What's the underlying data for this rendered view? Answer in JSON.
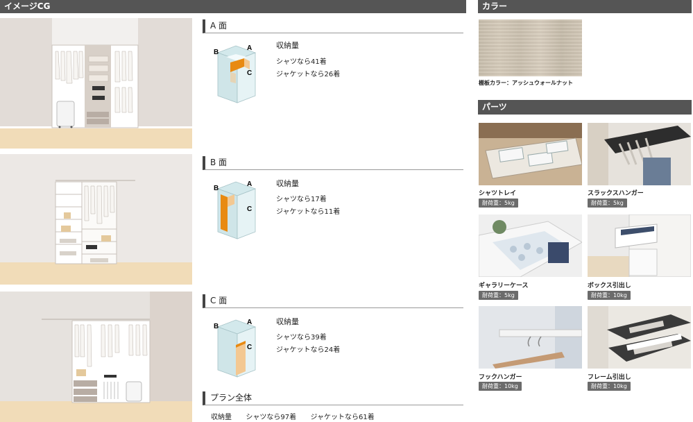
{
  "headers": {
    "image_cg": "イメージCG",
    "color": "カラー",
    "parts": "パーツ"
  },
  "sections": [
    {
      "title": "A 面",
      "capacity_label": "収納量",
      "shirts": "シャツなら41着",
      "jackets": "ジャケットなら26着"
    },
    {
      "title": "B 面",
      "capacity_label": "収納量",
      "shirts": "シャツなら17着",
      "jackets": "ジャケットなら11着"
    },
    {
      "title": "C 面",
      "capacity_label": "収納量",
      "shirts": "シャツなら39着",
      "jackets": "ジャケットなら24着"
    }
  ],
  "iso_labels": {
    "a": "A",
    "b": "B",
    "c": "C"
  },
  "plan": {
    "title": "プラン全体",
    "capacity_label": "収納量",
    "shirts": "シャツなら97着",
    "jackets": "ジャケットなら61着"
  },
  "color": {
    "caption": "棚板カラー：アッシュウォールナット",
    "swatch_color": "#cfc5b4"
  },
  "parts": [
    {
      "name": "シャツトレイ",
      "load": "耐荷重：5kg"
    },
    {
      "name": "スラックスハンガー",
      "load": "耐荷重：5kg"
    },
    {
      "name": "ギャラリーケース",
      "load": "耐荷重：5kg"
    },
    {
      "name": "ボックス引出し",
      "load": "耐荷重：10kg"
    },
    {
      "name": "フックハンガー",
      "load": "耐荷重：10kg"
    },
    {
      "name": "フレーム引出し",
      "load": "耐荷重：10kg"
    }
  ],
  "colors": {
    "header_bg": "#555555",
    "highlight": "#e88a12",
    "floor": "#f1dcb8",
    "wall": "#e4ddd8"
  }
}
